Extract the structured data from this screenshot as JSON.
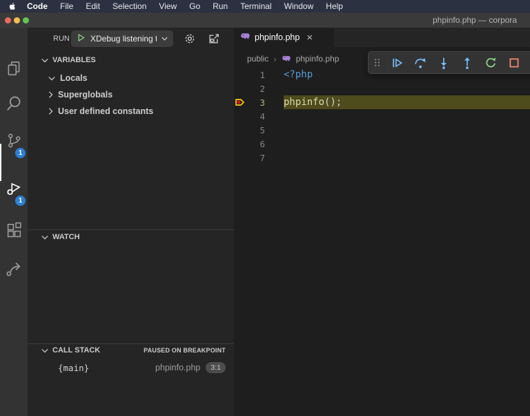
{
  "window": {
    "title": "phpinfo.php — corpora"
  },
  "menu_bar": {
    "items": [
      "Code",
      "File",
      "Edit",
      "Selection",
      "View",
      "Go",
      "Run",
      "Terminal",
      "Window",
      "Help"
    ]
  },
  "activity_bar": {
    "icons": [
      "files-icon",
      "search-icon",
      "source-control-icon",
      "run-and-debug-icon",
      "extensions-icon",
      "share-icon"
    ],
    "active_item": "run-and-debug",
    "source_control_badge": "1",
    "debug_badge": "1"
  },
  "sidebar": {
    "run": {
      "label": "RUN",
      "config_name": "XDebug listening t",
      "icons": [
        "start-debug-icon",
        "gear-icon",
        "debug-console-icon"
      ]
    },
    "variables": {
      "title": "VARIABLES",
      "items": [
        {
          "label": "Locals",
          "expanded": true
        },
        {
          "label": "Superglobals",
          "expanded": false
        },
        {
          "label": "User defined constants",
          "expanded": false
        }
      ]
    },
    "watch": {
      "title": "WATCH"
    },
    "call_stack": {
      "title": "CALL STACK",
      "status": "PAUSED ON BREAKPOINT",
      "frames": [
        {
          "name": "{main}",
          "file": "phpinfo.php",
          "location": "3:1"
        }
      ]
    }
  },
  "editor": {
    "tab": {
      "label": "phpinfo.php",
      "close": "×"
    },
    "breadcrumb": {
      "folder": "public",
      "separator": "›",
      "file": "phpinfo.php"
    },
    "debug_toolbar": {
      "icons": [
        "drag-handle",
        "continue",
        "step-over",
        "step-into",
        "step-out",
        "restart",
        "stop"
      ]
    },
    "lines": [
      {
        "num": "1",
        "php_tag": "<?php"
      },
      {
        "num": "2"
      },
      {
        "num": "3",
        "fn": "phpinfo",
        "punct": "();"
      },
      {
        "num": "4"
      },
      {
        "num": "5"
      },
      {
        "num": "6"
      },
      {
        "num": "7"
      }
    ],
    "current_line": 3,
    "breakpoint_line": 3
  },
  "colors": {
    "menubar_bg": "#2c3142",
    "titlebar_bg": "#3a3a3a",
    "activitybar_bg": "#333333",
    "sidebar_bg": "#252526",
    "editor_bg": "#1e1e1e",
    "badge_blue": "#2b7fd4",
    "debug_line_highlight": "#4e4b1d",
    "breakpoint_yellow": "#ffcc00",
    "breakpoint_red": "#e51400",
    "debug_icon_blue": "#75beff",
    "restart_green": "#89d185",
    "stop_red": "#f48771",
    "php_tag_blue": "#569cd6",
    "function_yellow": "#dcdcaa",
    "php_icon_purple": "#a87fd6"
  }
}
